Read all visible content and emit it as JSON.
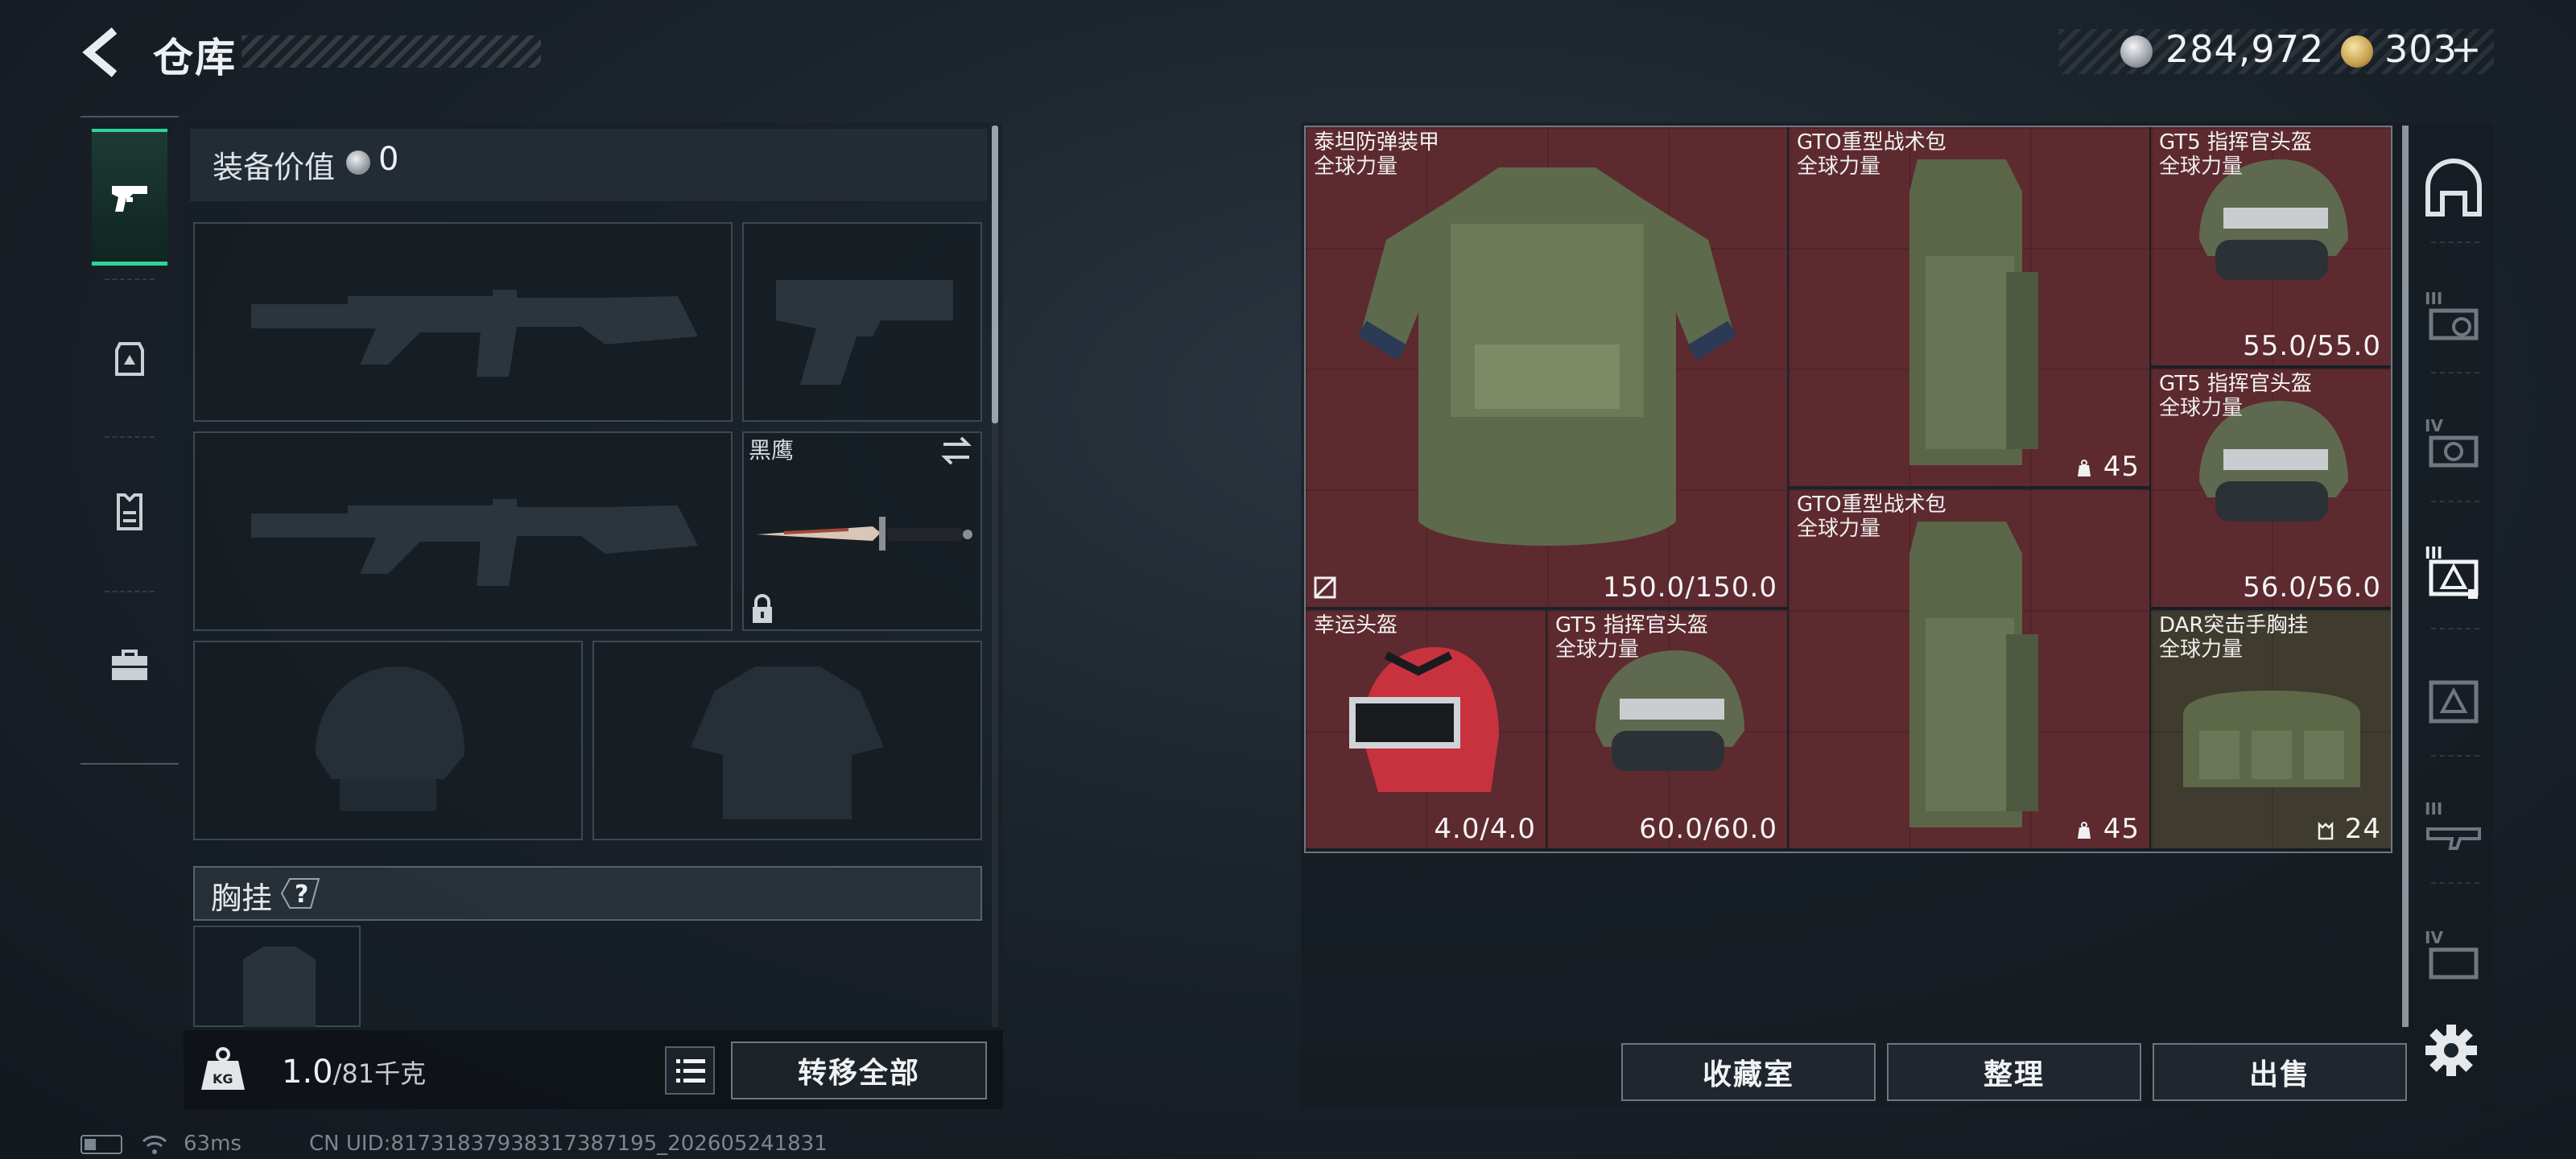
{
  "header": {
    "title": "仓库",
    "silver_amount": "284,972",
    "gold_amount": "303",
    "gold_add": "+"
  },
  "loadout": {
    "tabs": [
      "weapon",
      "backpack-equip",
      "vest",
      "toolbox"
    ],
    "value_label": "装备价值",
    "value_amount": "0",
    "knife_name": "黑鹰",
    "chest_label": "胸挂",
    "chest_help": "?",
    "weight_current": "1.0",
    "weight_max": "/81千克",
    "transfer_all": "转移全部"
  },
  "items": [
    {
      "name": "泰坦防弹装甲",
      "sub": "全球力量",
      "value": "150.0/150.0"
    },
    {
      "name": "GTO重型战术包",
      "sub": "全球力量",
      "value": "45"
    },
    {
      "name": "GT5 指挥官头盔",
      "sub": "全球力量",
      "value": "55.0/55.0"
    },
    {
      "name": "GT5 指挥官头盔",
      "sub": "全球力量",
      "value": "56.0/56.0"
    },
    {
      "name": "GTO重型战术包",
      "sub": "全球力量",
      "value": "45"
    },
    {
      "name": "幸运头盔",
      "sub": "",
      "value": "4.0/4.0"
    },
    {
      "name": "GT5 指挥官头盔",
      "sub": "全球力量",
      "value": "60.0/60.0"
    },
    {
      "name": "DAR突击手胸挂",
      "sub": "全球力量",
      "value": "24"
    }
  ],
  "actions": {
    "collection": "收藏室",
    "sort": "整理",
    "sell": "出售"
  },
  "rail": {
    "tier_labels": [
      "III",
      "IV",
      "III",
      "III",
      "IV"
    ]
  },
  "status": {
    "ping": "63ms",
    "uid": "CN UID:817318379383173871​95_202605241831"
  },
  "colors": {
    "accent": "#2ed49a",
    "item_bg": "#5d2a30",
    "item_bg_gold": "#3f3c2f"
  }
}
